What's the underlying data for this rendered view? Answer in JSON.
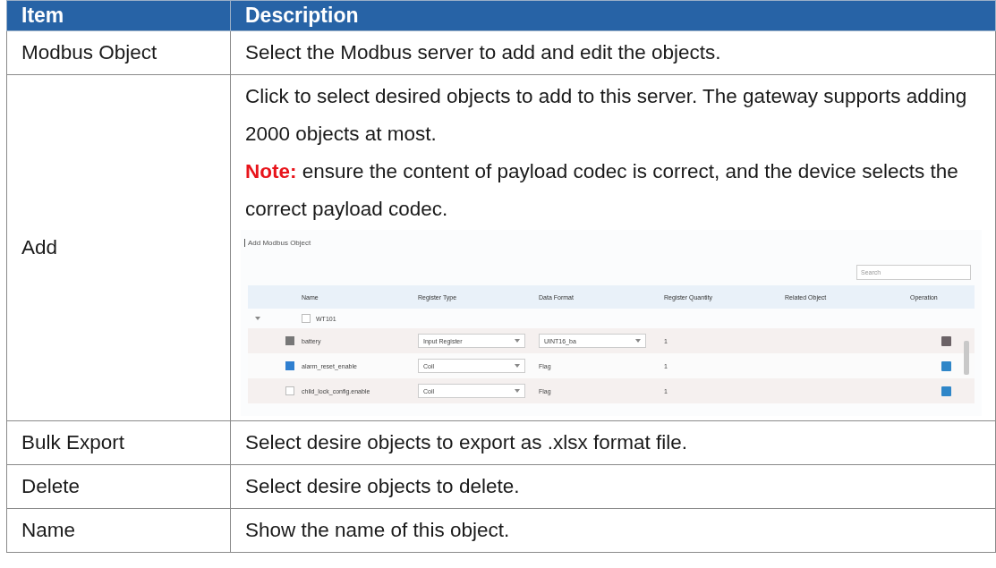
{
  "table": {
    "columns": [
      "Item",
      "Description"
    ],
    "rows": [
      {
        "kind": "text",
        "item": "Modbus Object",
        "paragraphs": [
          "Select the Modbus server to add and edit the objects."
        ]
      },
      {
        "kind": "screenshot",
        "item": "Add",
        "paragraphs": [
          "Click to select desired objects to add to this server. The gateway supports adding 2000 objects at most.",
          "**Note:** ensure the content of payload codec is correct, and the device selects the correct payload codec."
        ],
        "screenshot": {
          "title": "Add Modbus Object",
          "search": {
            "placeholder": "Search"
          },
          "columns": [
            "Name",
            "Register Type",
            "Data Format",
            "Register Quantity",
            "Related Object",
            "Operation"
          ],
          "group": {
            "name": "WT101",
            "checked": false,
            "expanded": true
          },
          "objects": [
            {
              "name": "battery",
              "checked": true,
              "disabled": true,
              "register_type": "Input Register",
              "data_format": "UINT16_ba",
              "data_format_select": true,
              "quantity": "1"
            },
            {
              "name": "alarm_reset_enable",
              "checked": true,
              "disabled": false,
              "register_type": "Coil",
              "data_format": "Flag",
              "data_format_select": false,
              "quantity": "1"
            },
            {
              "name": "child_lock_config.enable",
              "checked": false,
              "disabled": false,
              "register_type": "Coil",
              "data_format": "Flag",
              "data_format_select": false,
              "quantity": "1"
            }
          ]
        }
      },
      {
        "kind": "text",
        "item": "Bulk Export",
        "paragraphs": [
          "Select desire objects to export as .xlsx format file."
        ]
      },
      {
        "kind": "text",
        "item": "Delete",
        "paragraphs": [
          "Select desire objects to delete."
        ]
      },
      {
        "kind": "text",
        "item": "Name",
        "paragraphs": [
          "Show the name of this object."
        ]
      }
    ]
  }
}
